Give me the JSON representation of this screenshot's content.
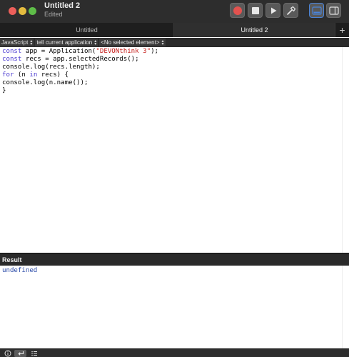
{
  "window": {
    "title": "Untitled 2",
    "subtitle": "Edited"
  },
  "toolbar": {
    "record_icon": "record-icon",
    "stop_icon": "stop-icon",
    "run_icon": "play-icon",
    "compile_icon": "hammer-icon",
    "view_editor_result_icon": "split-bottom-icon",
    "view_side_icon": "split-right-icon",
    "accent": "#4a84d9",
    "record_color": "#e2524f"
  },
  "tabs": [
    {
      "label": "Untitled",
      "selected": false
    },
    {
      "label": "Untitled 2",
      "selected": true
    }
  ],
  "tab_add_label": "+",
  "navbar": {
    "language": "JavaScript",
    "target": "tell current application",
    "element": "<No selected element>"
  },
  "code": [
    [
      {
        "t": "const",
        "c": "kw"
      },
      {
        "t": " app = Application(",
        "c": ""
      },
      {
        "t": "\"DEVONthink 3\"",
        "c": "str"
      },
      {
        "t": ");",
        "c": ""
      }
    ],
    [
      {
        "t": "const",
        "c": "kw"
      },
      {
        "t": " recs = app.selectedRecords();",
        "c": ""
      }
    ],
    [
      {
        "t": "console.log(recs.length);",
        "c": ""
      }
    ],
    [
      {
        "t": "for",
        "c": "kw"
      },
      {
        "t": " (n ",
        "c": ""
      },
      {
        "t": "in",
        "c": "kw"
      },
      {
        "t": " recs) {",
        "c": ""
      }
    ],
    [
      {
        "t": "console.log(n.name());",
        "c": ""
      }
    ],
    [
      {
        "t": "}",
        "c": ""
      }
    ]
  ],
  "result": {
    "header": "Result",
    "output": "undefined"
  },
  "bottom_bar": {
    "buttons": [
      "info-icon",
      "reply-icon",
      "list-icon"
    ]
  }
}
